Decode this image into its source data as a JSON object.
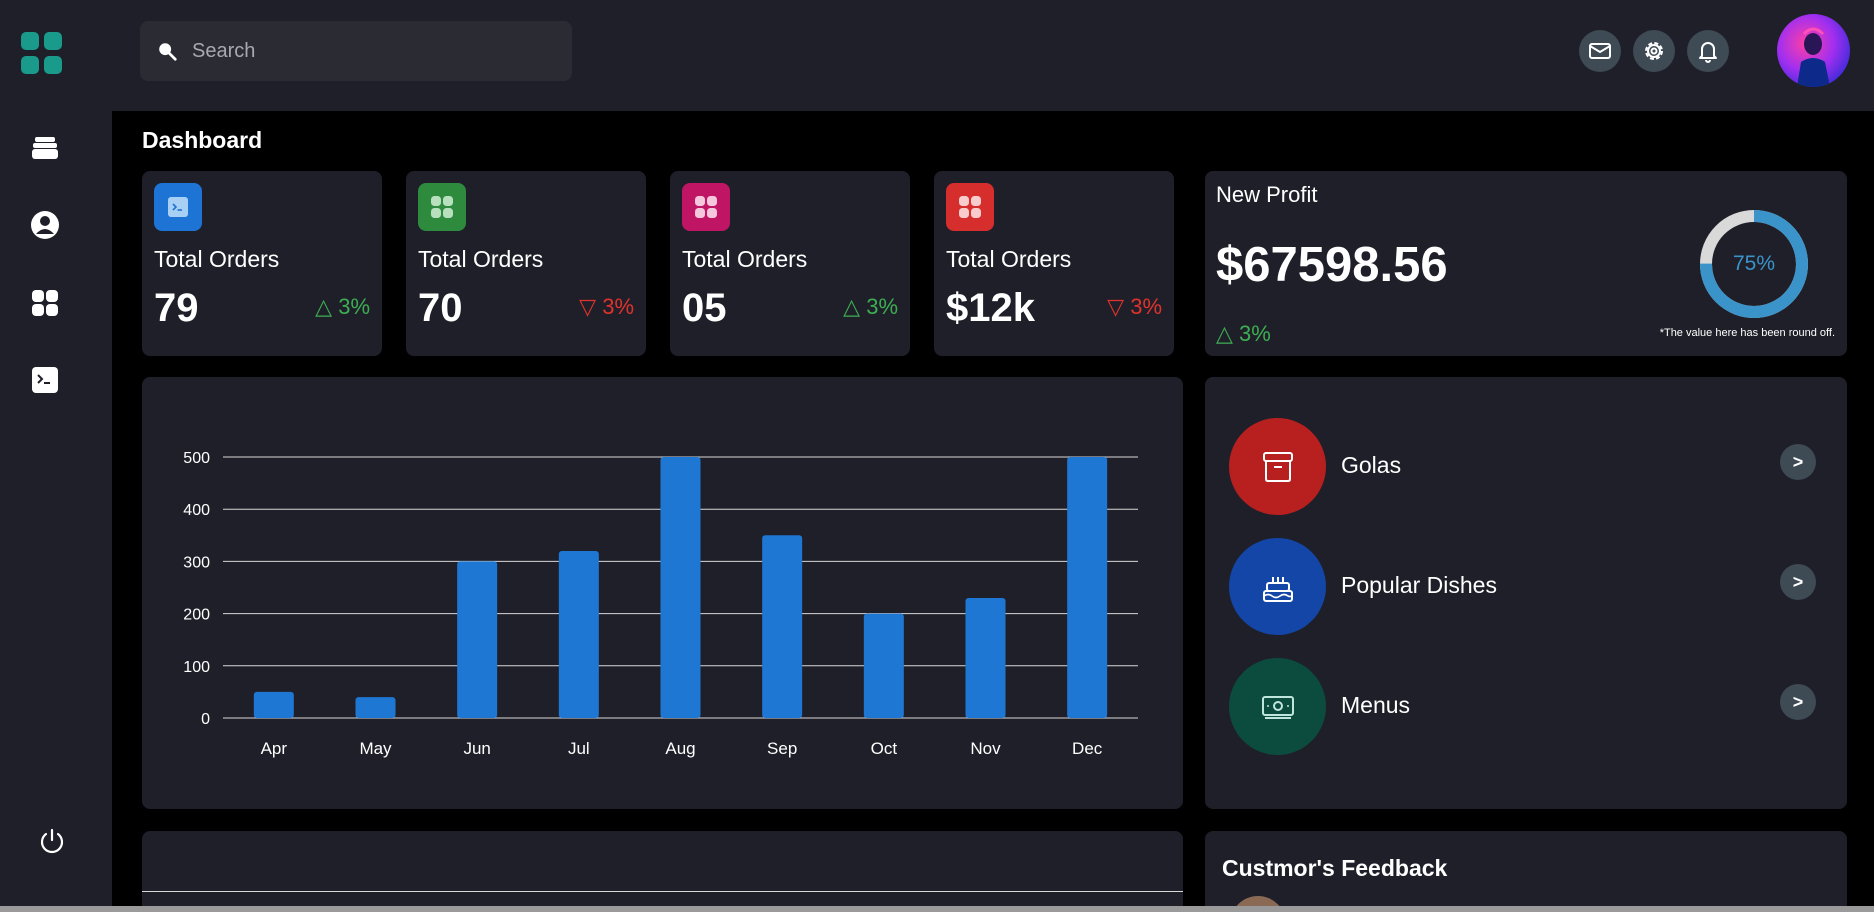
{
  "search": {
    "placeholder": "Search"
  },
  "page": {
    "title": "Dashboard"
  },
  "stats": [
    {
      "label": "Total Orders",
      "value": "79",
      "change": "△ 3%",
      "trend": "up",
      "icon": "terminal-icon",
      "color": "#1e74d4"
    },
    {
      "label": "Total Orders",
      "value": "70",
      "change": "▽ 3%",
      "trend": "down",
      "icon": "grid-icon",
      "color": "#2e8b3e"
    },
    {
      "label": "Total Orders",
      "value": "05",
      "change": "△ 3%",
      "trend": "up",
      "icon": "grid-icon",
      "color": "#c01565"
    },
    {
      "label": "Total Orders",
      "value": "$12k",
      "change": "▽ 3%",
      "trend": "down",
      "icon": "grid-icon",
      "color": "#d62d2d"
    }
  ],
  "profit": {
    "label": "New Profit",
    "value": "$67598.56",
    "change": "△ 3%",
    "percent_label": "75%",
    "percent": 0.75,
    "note": "*The value here has been round off."
  },
  "chart_data": {
    "type": "bar",
    "categories": [
      "Apr",
      "May",
      "Jun",
      "Jul",
      "Aug",
      "Sep",
      "Oct",
      "Nov",
      "Dec"
    ],
    "values": [
      50,
      40,
      300,
      320,
      500,
      350,
      200,
      230,
      500
    ],
    "yticks": [
      0,
      100,
      200,
      300,
      400,
      500
    ],
    "ylim": [
      0,
      500
    ],
    "title": "",
    "xlabel": "",
    "ylabel": "",
    "color": "#1f77d4",
    "grid": true
  },
  "nav": [
    {
      "label": "Golas",
      "icon": "archive-box-icon",
      "color": "#b82020",
      "arrow": ">"
    },
    {
      "label": "Popular Dishes",
      "icon": "cake-icon",
      "color": "#1346a6",
      "arrow": ">"
    },
    {
      "label": "Menus",
      "icon": "money-icon",
      "color": "#0c4c3e",
      "arrow": ">"
    }
  ],
  "feedback": {
    "title": "Custmor's Feedback"
  },
  "colors": {
    "background": "#000000",
    "card": "#1f1f29",
    "accent": "#1a9a8a",
    "up": "#3daf52",
    "down": "#e0332c"
  }
}
